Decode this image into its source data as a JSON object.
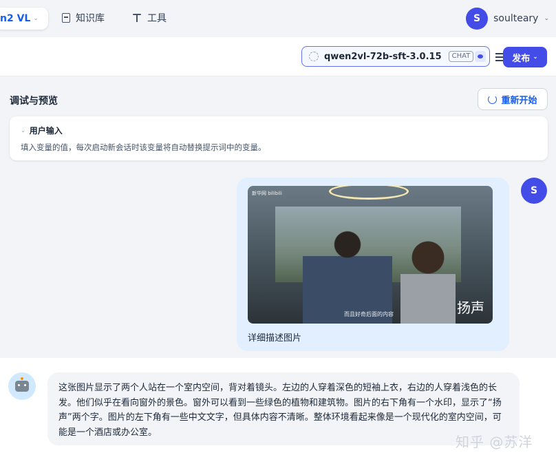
{
  "nav": {
    "app_name": "n2 VL",
    "knowledge_label": "知识库",
    "tools_label": "工具",
    "user_initial": "S",
    "username": "soulteary"
  },
  "toolbar": {
    "model_name": "qwen2vl-72b-sft-3.0.15",
    "model_mode": "CHAT",
    "publish_label": "发布"
  },
  "debug": {
    "title": "调试与预览",
    "restart_label": "重新开始",
    "user_input_title": "用户输入",
    "user_input_desc": "填入变量的值，每次启动新会话时该变量将自动替换提示词中的变量。"
  },
  "chat": {
    "user_avatar_initial": "S",
    "image_watermark_top_left": "新华网 bilibili",
    "image_subtitle": "而且好奇后面的内容",
    "image_watermark": "扬声",
    "user_message": "详细描述图片",
    "bot_message": "这张图片显示了两个人站在一个室内空间，背对着镜头。左边的人穿着深色的短袖上衣，右边的人穿着浅色的长发。他们似乎在看向窗外的景色。窗外可以看到一些绿色的植物和建筑物。图片的右下角有一个水印，显示了“扬声”两个字。图片的左下角有一些中文文字，但具体内容不清晰。整体环境看起来像是一个现代化的室内空间，可能是一个酒店或办公室。"
  },
  "watermark": "知乎 @苏洋",
  "colors": {
    "accent": "#444ce7",
    "link": "#155eef",
    "user_bubble": "#e1effe"
  }
}
